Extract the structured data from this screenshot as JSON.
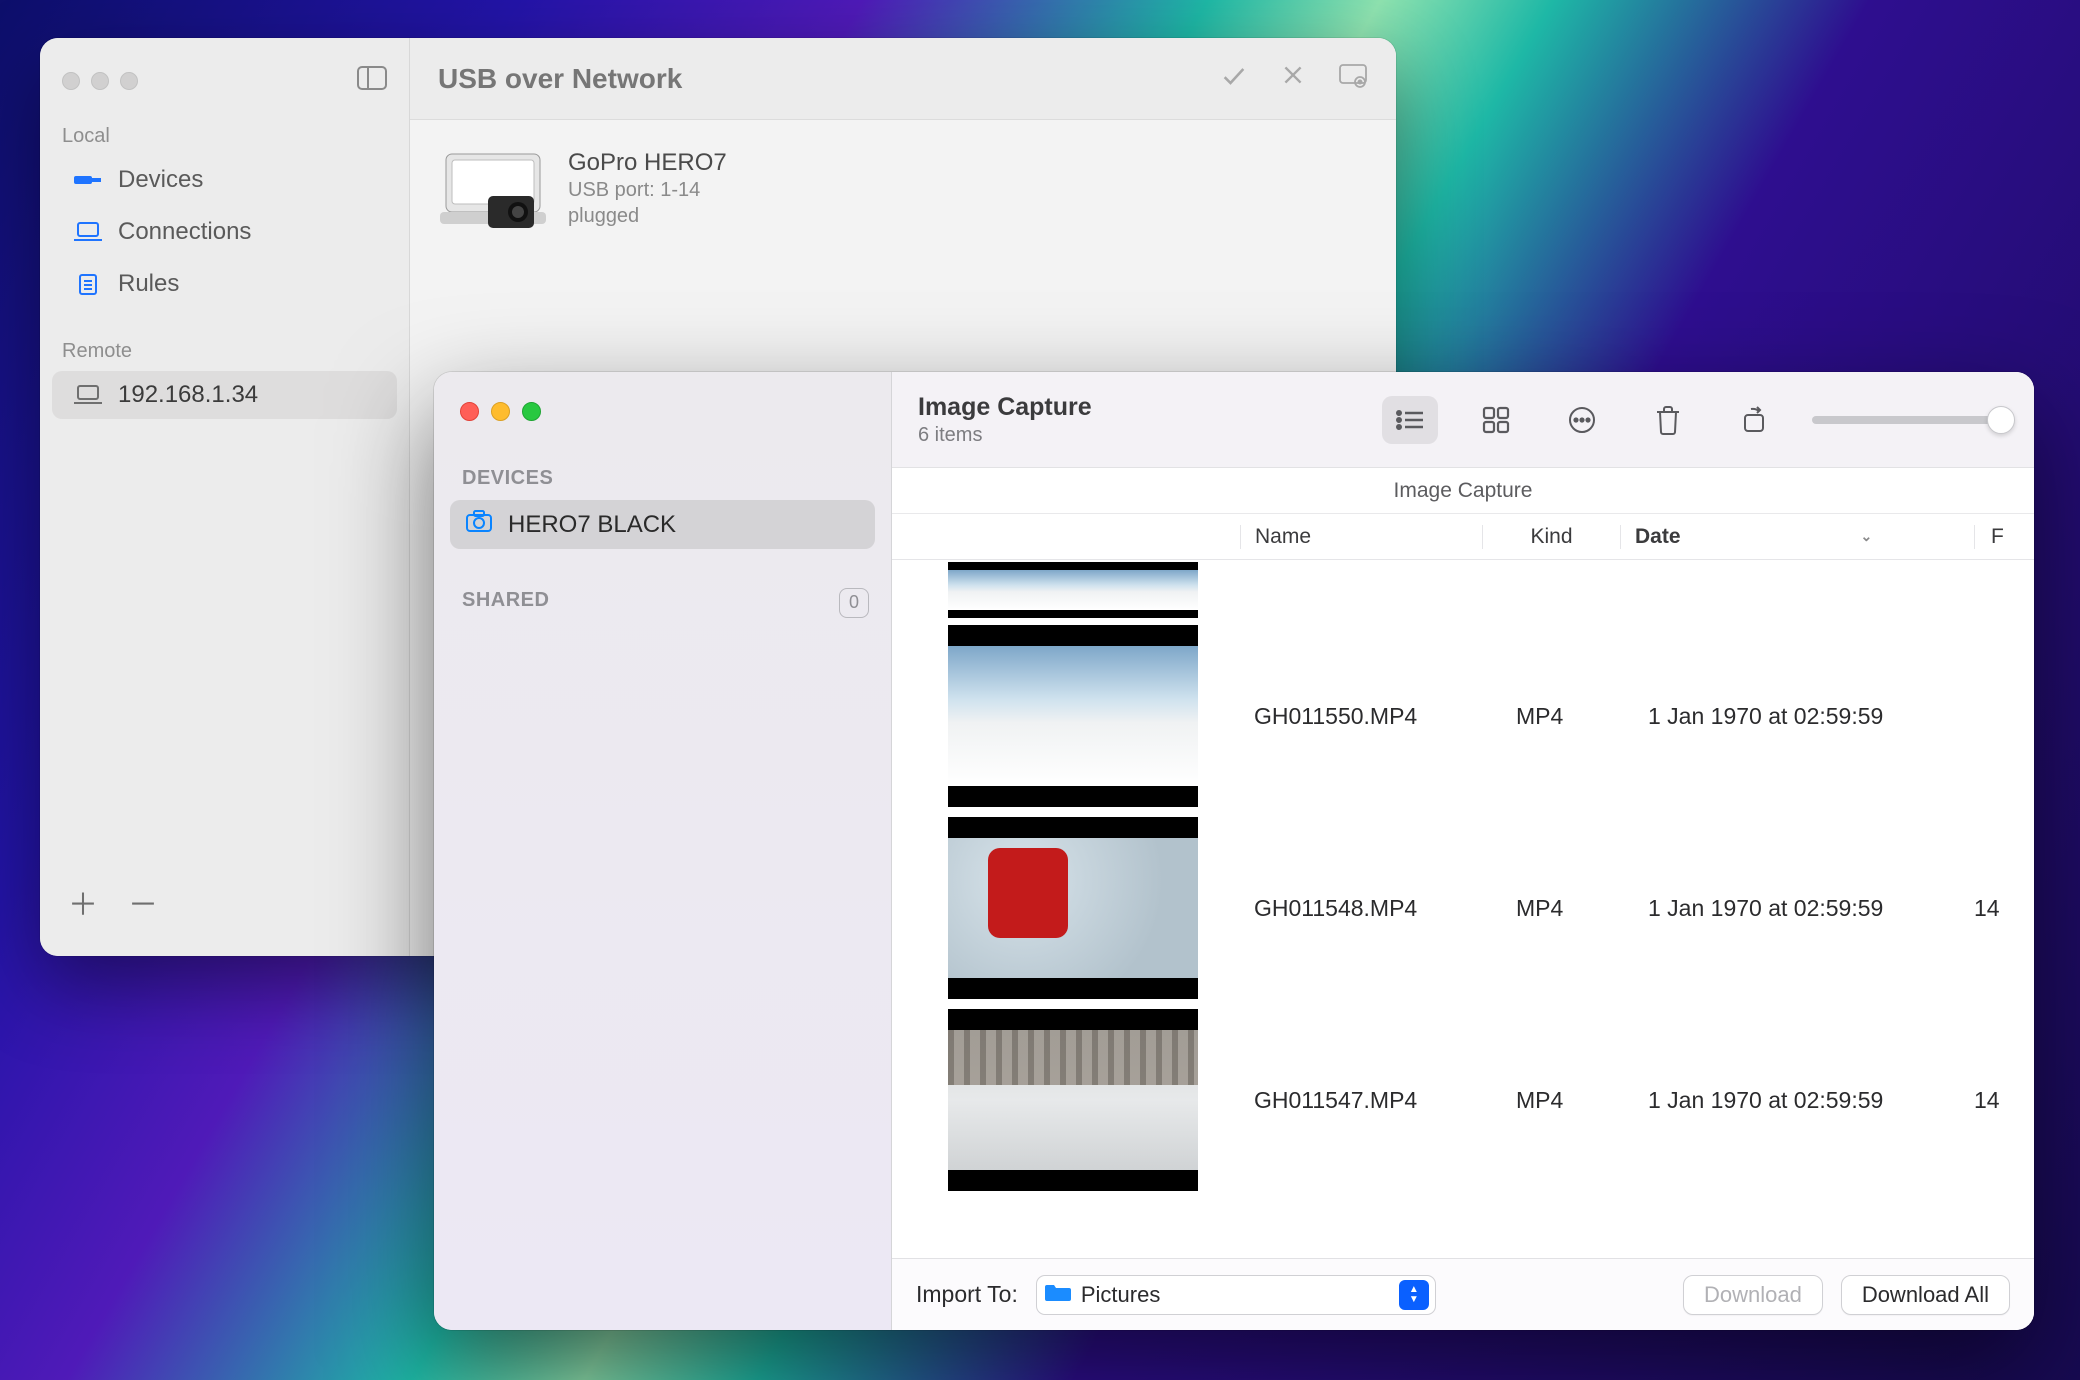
{
  "usb_window": {
    "title": "USB over Network",
    "sidebar": {
      "local_label": "Local",
      "remote_label": "Remote",
      "items_local": [
        {
          "label": "Devices",
          "icon": "usb-icon"
        },
        {
          "label": "Connections",
          "icon": "laptop-icon"
        },
        {
          "label": "Rules",
          "icon": "clipboard-icon"
        }
      ],
      "items_remote": [
        {
          "label": "192.168.1.34",
          "icon": "laptop-icon"
        }
      ]
    },
    "device": {
      "name": "GoPro HERO7",
      "port": "USB port: 1-14",
      "status": "plugged"
    }
  },
  "image_capture": {
    "title": "Image Capture",
    "subtitle": "6 items",
    "devices_label": "DEVICES",
    "selected_device": "HERO7 BLACK",
    "shared_label": "SHARED",
    "shared_count": "0",
    "subtitle_bar": "Image Capture",
    "columns": {
      "name": "Name",
      "kind": "Kind",
      "date": "Date",
      "extra": "F"
    },
    "files": [
      {
        "name": "GH011550.MP4",
        "kind": "MP4",
        "date": "1 Jan 1970 at 02:59:59",
        "extra": ""
      },
      {
        "name": "GH011548.MP4",
        "kind": "MP4",
        "date": "1 Jan 1970 at 02:59:59",
        "extra": "14"
      },
      {
        "name": "GH011547.MP4",
        "kind": "MP4",
        "date": "1 Jan 1970 at 02:59:59",
        "extra": "14"
      }
    ],
    "footer": {
      "import_to_label": "Import To:",
      "folder": "Pictures",
      "download": "Download",
      "download_all": "Download All"
    }
  }
}
